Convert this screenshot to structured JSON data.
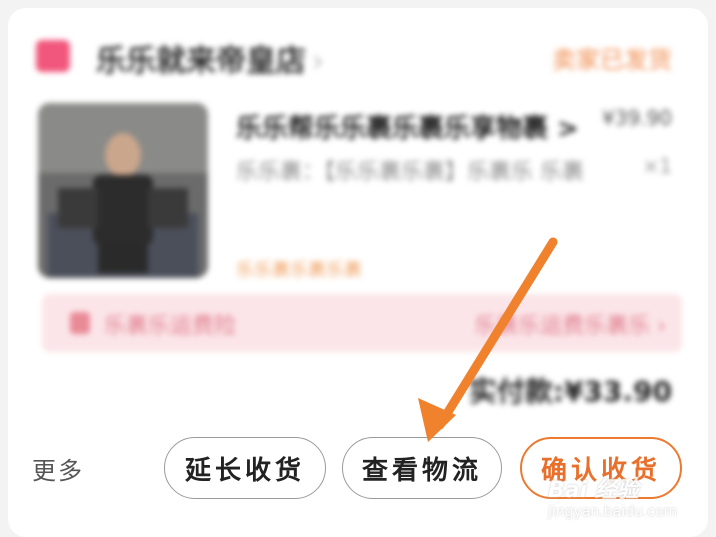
{
  "order_card": {
    "shop": {
      "name": "乐乐就来帝皇店",
      "chevron": "›",
      "status": "卖家已发货"
    },
    "product": {
      "title": "乐乐帮乐乐裹乐裹乐享物裹 >",
      "spec": "乐乐裹：【乐乐裹乐裹】乐裹乐 乐裹",
      "tag": "乐乐裹乐裹乐裹",
      "price": "¥39.90",
      "quantity": "×1"
    },
    "insurance": {
      "label": "乐裹乐运费险",
      "right_text": "乐裹乐运费乐裹乐 ›"
    },
    "paid": "实付款:¥33.90"
  },
  "actions": {
    "more_label": "更多",
    "extend_label": "延长收货",
    "logistics_label": "查看物流",
    "confirm_label": "确认收货"
  },
  "annotation": {
    "arrow_color": "#f0822e"
  },
  "watermark": {
    "brand": "Bai 经验",
    "url": "jingyan.baidu.com"
  }
}
